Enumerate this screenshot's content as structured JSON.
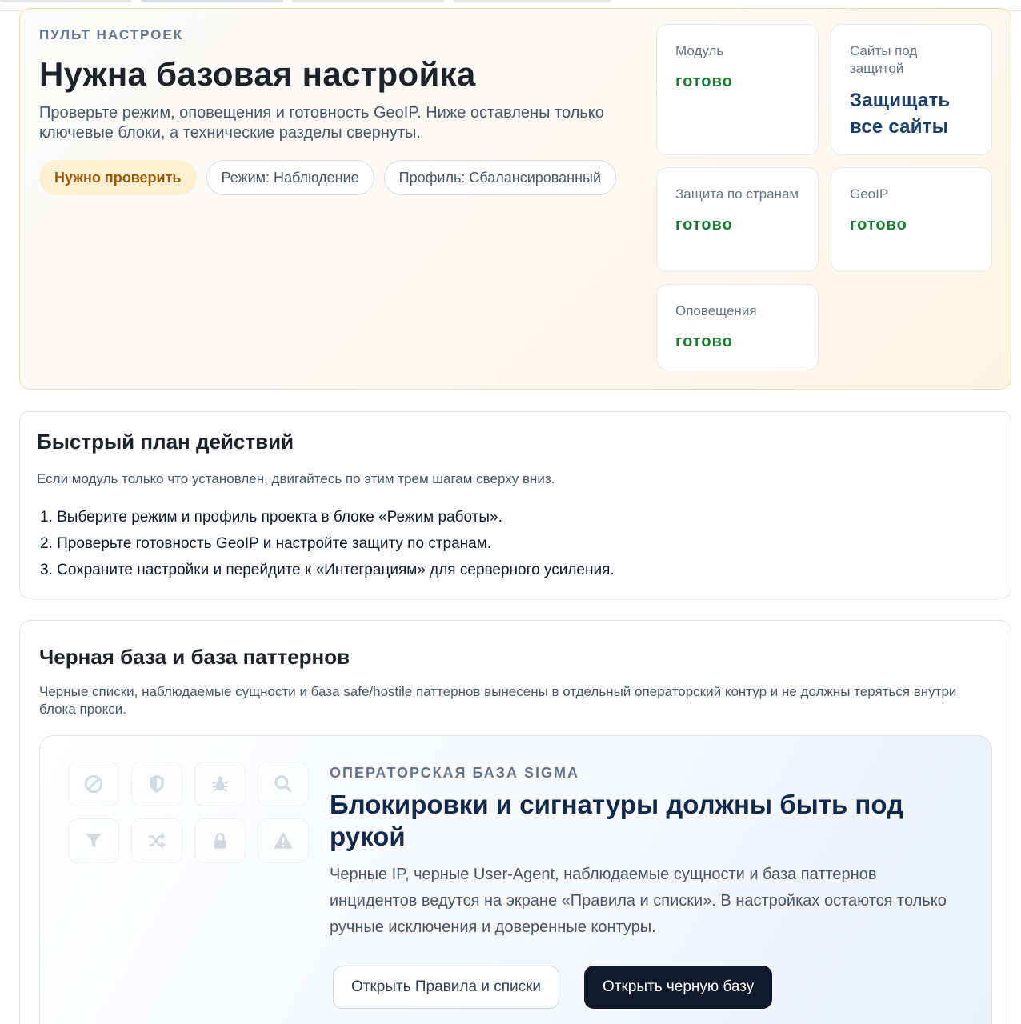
{
  "hero": {
    "eyebrow": "ПУЛЬТ НАСТРОЕК",
    "title": "Нужна базовая настройка",
    "description": "Проверьте режим, оповещения и готовность GeoIP. Ниже оставлены только ключевые блоки, а технические разделы свернуты.",
    "pills": {
      "status": "Нужно проверить",
      "mode": "Режим: Наблюдение",
      "profile": "Профиль: Сбалансированный"
    },
    "stats": {
      "module": {
        "label": "Модуль",
        "value": "готово"
      },
      "sites": {
        "label": "Сайты под защитой",
        "value": "Защищать все сайты"
      },
      "countries": {
        "label": "Защита по странам",
        "value": "готово"
      },
      "geoip": {
        "label": "GeoIP",
        "value": "готово"
      },
      "alerts": {
        "label": "Оповещения",
        "value": "готово"
      }
    }
  },
  "plan": {
    "title": "Быстрый план действий",
    "subtitle": "Если модуль только что установлен, двигайтесь по этим трем шагам сверху вниз.",
    "steps": [
      "1. Выберите режим и профиль проекта в блоке «Режим работы».",
      "2. Проверьте готовность GeoIP и настройте защиту по странам.",
      "3. Сохраните настройки и перейдите к «Интеграциям» для серверного усиления."
    ]
  },
  "blacklist": {
    "title": "Черная база и база паттернов",
    "subtitle": "Черные списки, наблюдаемые сущности и база safe/hostile паттернов вынесены в отдельный операторский контур и не должны теряться внутри блока прокси.",
    "sigma": {
      "eyebrow": "ОПЕРАТОРСКАЯ БАЗА SIGMA",
      "title": "Блокировки и сигнатуры должны быть под рукой",
      "description": "Черные IP, черные User-Agent, наблюдаемые сущности и база паттернов инцидентов ведутся на экране «Правила и списки». В настройках остаются только ручные исключения и доверенные контуры.",
      "icons": [
        "ban-icon",
        "shield-icon",
        "bug-icon",
        "search-icon",
        "filter-icon",
        "shuffle-icon",
        "lock-icon",
        "warning-icon"
      ],
      "btn_rules": "Открыть Правила и списки",
      "btn_black": "Открыть черную базу"
    }
  },
  "colors": {
    "ready": "#1e7b34",
    "accent_blue": "#1d3f66",
    "warn_bg": "#fdefd2",
    "warn_text": "#9a5a0b",
    "dark_button": "#0f1a2b"
  }
}
